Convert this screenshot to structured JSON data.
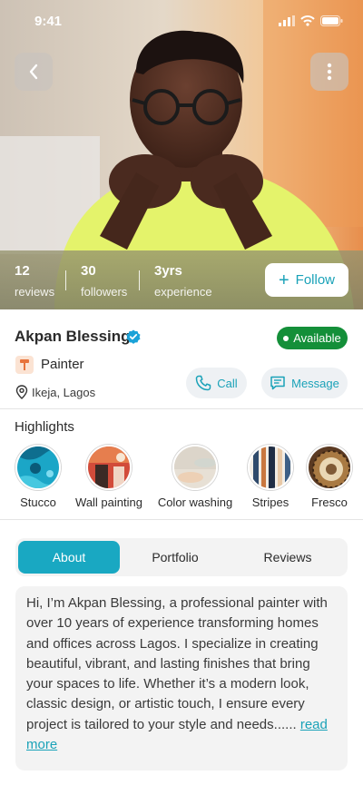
{
  "status_bar": {
    "time": "9:41"
  },
  "profile": {
    "name": "Akpan Blessing",
    "availability": "Available",
    "role": "Painter",
    "location": "Ikeja, Lagos"
  },
  "stats": [
    {
      "value": "12",
      "label": "reviews"
    },
    {
      "value": "30",
      "label": "followers"
    },
    {
      "value": "3yrs",
      "label": "experience"
    }
  ],
  "actions": {
    "follow": "Follow",
    "call": "Call",
    "message": "Message"
  },
  "highlights": {
    "title": "Highlights",
    "items": [
      {
        "label": "Stucco"
      },
      {
        "label": "Wall painting"
      },
      {
        "label": "Color washing"
      },
      {
        "label": "Stripes"
      },
      {
        "label": "Fresco"
      }
    ]
  },
  "tabs": [
    {
      "label": "About",
      "active": true
    },
    {
      "label": "Portfolio",
      "active": false
    },
    {
      "label": "Reviews",
      "active": false
    }
  ],
  "about": {
    "text": "Hi, I’m Akpan Blessing, a professional painter with over 10 years of experience transforming homes and offices across Lagos. I specialize in creating beautiful, vibrant, and lasting finishes that bring your spaces to life. Whether it’s a modern look, classic design, or artistic touch, I ensure every project is tailored to your style and needs......",
    "read_more": "read more"
  },
  "colors": {
    "accent": "#1aa2b8",
    "available": "#148f39",
    "tab_active": "#19a8c2",
    "card_bg": "#f3f3f3"
  }
}
